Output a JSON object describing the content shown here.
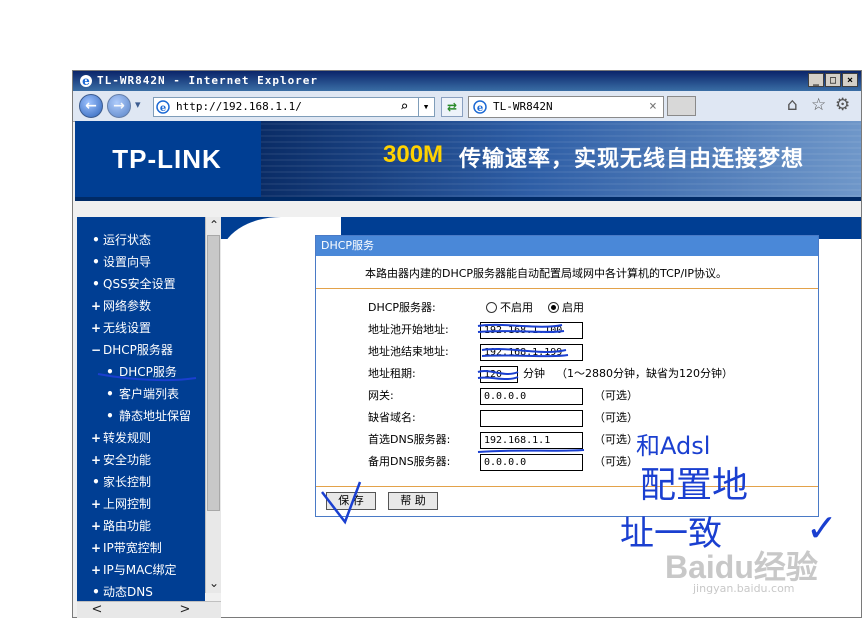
{
  "window": {
    "title": "TL-WR842N - Internet Explorer",
    "min": "_",
    "max": "□",
    "close": "×"
  },
  "toolbar": {
    "back": "←",
    "forward": "→",
    "dropdown": "▾",
    "address": "http://192.168.1.1/",
    "search_glyph": "⌕",
    "address_dropdown": "▾",
    "refresh": "⇄",
    "tab_title": "TL-WR842N",
    "tab_close": "×",
    "home": "⌂",
    "favorites": "☆",
    "tools": "⚙"
  },
  "header": {
    "logo": "TP-LINK",
    "slogan_highlight": "300M",
    "slogan": "传输速率，实现无线自由连接梦想"
  },
  "sidebar": {
    "items": [
      {
        "marker": "•",
        "label": "运行状态"
      },
      {
        "marker": "•",
        "label": "设置向导"
      },
      {
        "marker": "•",
        "label": "QSS安全设置"
      },
      {
        "marker": "+",
        "label": "网络参数"
      },
      {
        "marker": "+",
        "label": "无线设置"
      },
      {
        "marker": "−",
        "label": "DHCP服务器"
      },
      {
        "marker": "•",
        "label": "DHCP服务"
      },
      {
        "marker": "•",
        "label": "客户端列表"
      },
      {
        "marker": "•",
        "label": "静态地址保留"
      },
      {
        "marker": "+",
        "label": "转发规则"
      },
      {
        "marker": "+",
        "label": "安全功能"
      },
      {
        "marker": "•",
        "label": "家长控制"
      },
      {
        "marker": "+",
        "label": "上网控制"
      },
      {
        "marker": "+",
        "label": "路由功能"
      },
      {
        "marker": "+",
        "label": "IP带宽控制"
      },
      {
        "marker": "+",
        "label": "IP与MAC绑定"
      },
      {
        "marker": "•",
        "label": "动态DNS"
      }
    ],
    "scroll_up": "⌃",
    "scroll_down": "⌄",
    "scroll_left": "<",
    "scroll_right": ">"
  },
  "panel": {
    "title": "DHCP服务",
    "description": "本路由器内建的DHCP服务器能自动配置局域网中各计算机的TCP/IP协议。",
    "dhcp_server_label": "DHCP服务器:",
    "disable_label": "不启用",
    "enable_label": "启用",
    "pool_start_label": "地址池开始地址:",
    "pool_start_value": "192.168.1.100",
    "pool_end_label": "地址池结束地址:",
    "pool_end_value": "192.168.1.199",
    "lease_label": "地址租期:",
    "lease_value": "120",
    "lease_unit": "分钟",
    "lease_note": "（1～2880分钟，缺省为120分钟）",
    "gateway_label": "网关:",
    "gateway_value": "0.0.0.0",
    "optional": "（可选）",
    "domain_label": "缺省域名:",
    "domain_value": "",
    "dns1_label": "首选DNS服务器:",
    "dns1_value": "192.168.1.1",
    "dns2_label": "备用DNS服务器:",
    "dns2_value": "0.0.0.0",
    "save_button": "保 存",
    "help_button": "帮 助"
  },
  "annotations": {
    "line1": "和Adsl",
    "line2": "配置地",
    "line3": "址一致",
    "check": "✓"
  },
  "watermark": {
    "brand": "Baidu经验",
    "url": "jingyan.baidu.com"
  }
}
